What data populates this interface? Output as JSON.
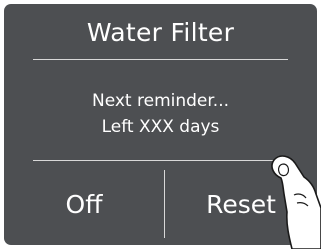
{
  "screen": {
    "title": "Water Filter",
    "message_line1": "Next reminder...",
    "message_line2": "Left XXX days"
  },
  "buttons": {
    "off_label": "Off",
    "reset_label": "Reset"
  },
  "colors": {
    "panel_background": "#4d4f52",
    "text": "#ffffff",
    "divider": "#d8d8d8"
  },
  "icons": {
    "pointer": "tapping-finger-icon"
  }
}
